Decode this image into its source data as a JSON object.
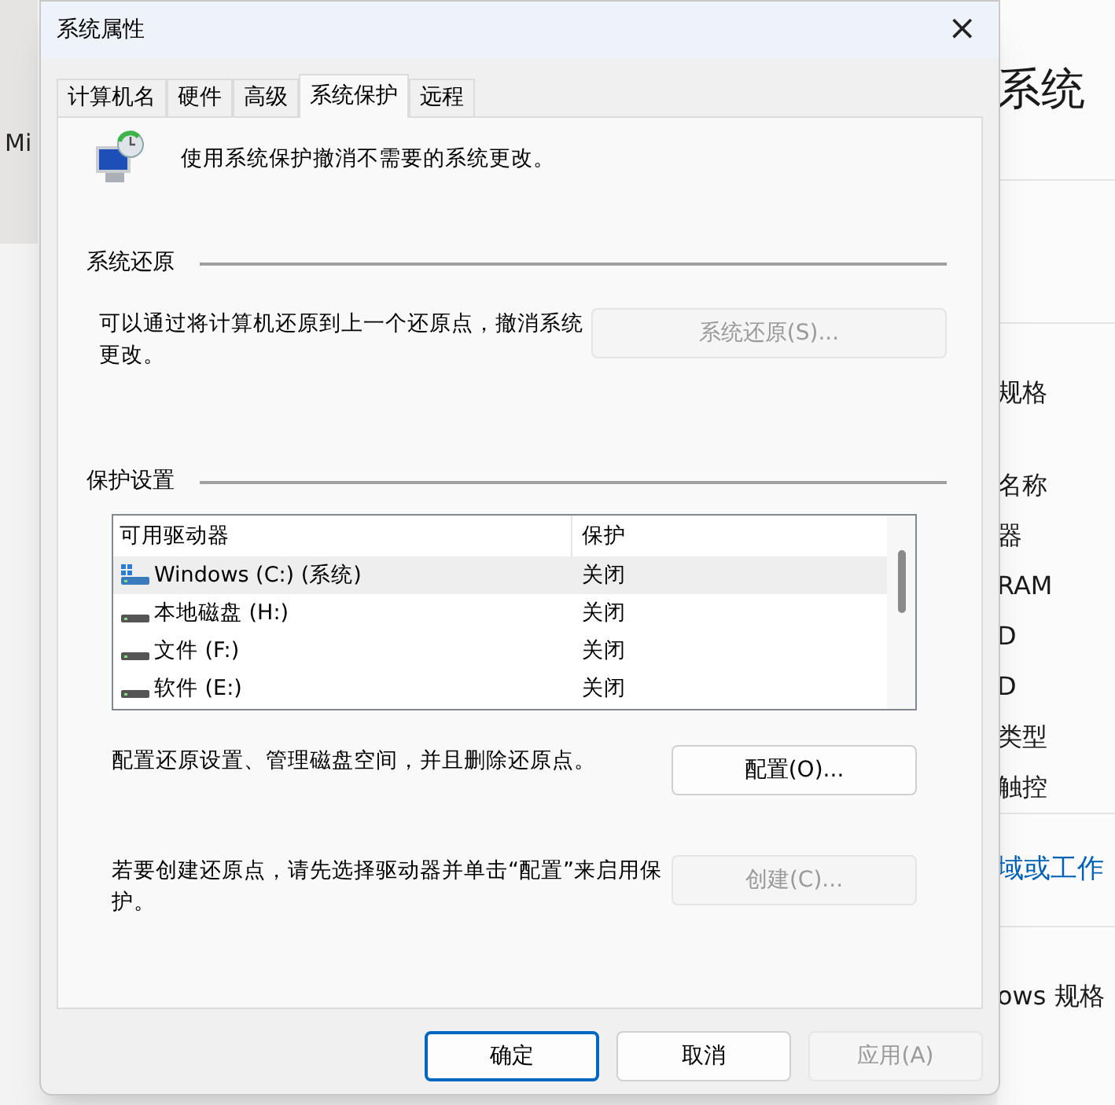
{
  "background_window": {
    "left_text": "Mi",
    "heading": "系统",
    "rows": [
      {
        "text": "规格",
        "kind": "section"
      },
      {
        "text": "名称",
        "kind": "item"
      },
      {
        "text": "器",
        "kind": "item"
      },
      {
        "text": "RAM",
        "kind": "item"
      },
      {
        "text": "D",
        "kind": "item"
      },
      {
        "text": "D",
        "kind": "item"
      },
      {
        "text": "类型",
        "kind": "item"
      },
      {
        "text": "触控",
        "kind": "item"
      },
      {
        "text": "域或工作",
        "kind": "link"
      },
      {
        "text": "ows 规格",
        "kind": "section"
      }
    ]
  },
  "window": {
    "title": "系统属性",
    "close": "×"
  },
  "tabs": [
    {
      "label": "计算机名",
      "selected": false
    },
    {
      "label": "硬件",
      "selected": false
    },
    {
      "label": "高级",
      "selected": false
    },
    {
      "label": "系统保护",
      "selected": true
    },
    {
      "label": "远程",
      "selected": false
    }
  ],
  "intro": "使用系统保护撤消不需要的系统更改。",
  "system_restore": {
    "heading": "系统还原",
    "description": "可以通过将计算机还原到上一个还原点，撤消系统更改。",
    "button": {
      "label": "系统还原(S)...",
      "disabled": true
    }
  },
  "protection": {
    "heading": "保护设置",
    "columns": [
      "可用驱动器",
      "保护"
    ],
    "drives": [
      {
        "name": "Windows (C:) (系统)",
        "protection": "关闭",
        "kind": "system",
        "selected": true
      },
      {
        "name": "本地磁盘 (H:)",
        "protection": "关闭",
        "kind": "disk",
        "selected": false
      },
      {
        "name": "文件 (F:)",
        "protection": "关闭",
        "kind": "disk",
        "selected": false
      },
      {
        "name": "软件 (E:)",
        "protection": "关闭",
        "kind": "disk",
        "selected": false
      }
    ],
    "configure_text": "配置还原设置、管理磁盘空间，并且删除还原点。",
    "configure_button": {
      "label": "配置(O)...",
      "disabled": false
    },
    "create_text": "若要创建还原点，请先选择驱动器并单击“配置”来启用保护。",
    "create_button": {
      "label": "创建(C)...",
      "disabled": true
    }
  },
  "buttons": [
    {
      "label": "确定",
      "disabled": false,
      "default": true
    },
    {
      "label": "取消",
      "disabled": false,
      "default": false
    },
    {
      "label": "应用(A)",
      "disabled": true,
      "default": false
    }
  ]
}
